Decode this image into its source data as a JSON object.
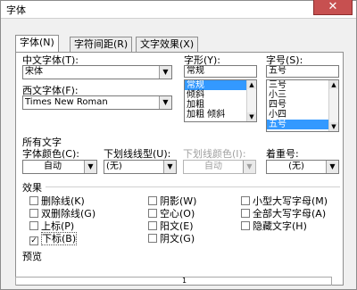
{
  "window": {
    "title": "字体",
    "close_glyph": "✕"
  },
  "tabs": [
    {
      "label": "字体(N)"
    },
    {
      "label": "字符间距(R)"
    },
    {
      "label": "文字效果(X)"
    }
  ],
  "font": {
    "chinese_label": "中文字体(T):",
    "chinese_value": "宋体",
    "western_label": "西文字体(F):",
    "western_value": "Times New Roman",
    "style_label": "字形(Y):",
    "style_value": "常规",
    "style_items": [
      "常规",
      "倾斜",
      "加粗",
      "加粗 倾斜"
    ],
    "size_label": "字号(S):",
    "size_value": "五号",
    "size_items": [
      "三号",
      "小三",
      "四号",
      "小四",
      "五号"
    ]
  },
  "all_text": {
    "section_label": "所有文字",
    "color_label": "字体颜色(C):",
    "color_value": "自动",
    "underline_label": "下划线线型(U):",
    "underline_value": "(无)",
    "underline_color_label": "下划线颜色(I):",
    "underline_color_value": "自动",
    "emphasis_label": "着重号:",
    "emphasis_value": "(无)"
  },
  "effects": {
    "section_label": "效果",
    "items": [
      {
        "label": "删除线(K)",
        "checked": false
      },
      {
        "label": "双删除线(G)",
        "checked": false
      },
      {
        "label": "上标(P)",
        "checked": false
      },
      {
        "label": "下标(B)",
        "checked": true
      },
      {
        "label": "阴影(W)",
        "checked": false
      },
      {
        "label": "空心(O)",
        "checked": false
      },
      {
        "label": "阳文(E)",
        "checked": false
      },
      {
        "label": "阴文(G)",
        "checked": false
      },
      {
        "label": "小型大写字母(M)",
        "checked": false
      },
      {
        "label": "全部大写字母(A)",
        "checked": false
      },
      {
        "label": "隐藏文字(H)",
        "checked": false
      }
    ]
  },
  "preview": {
    "label": "预览",
    "sample": "1"
  }
}
